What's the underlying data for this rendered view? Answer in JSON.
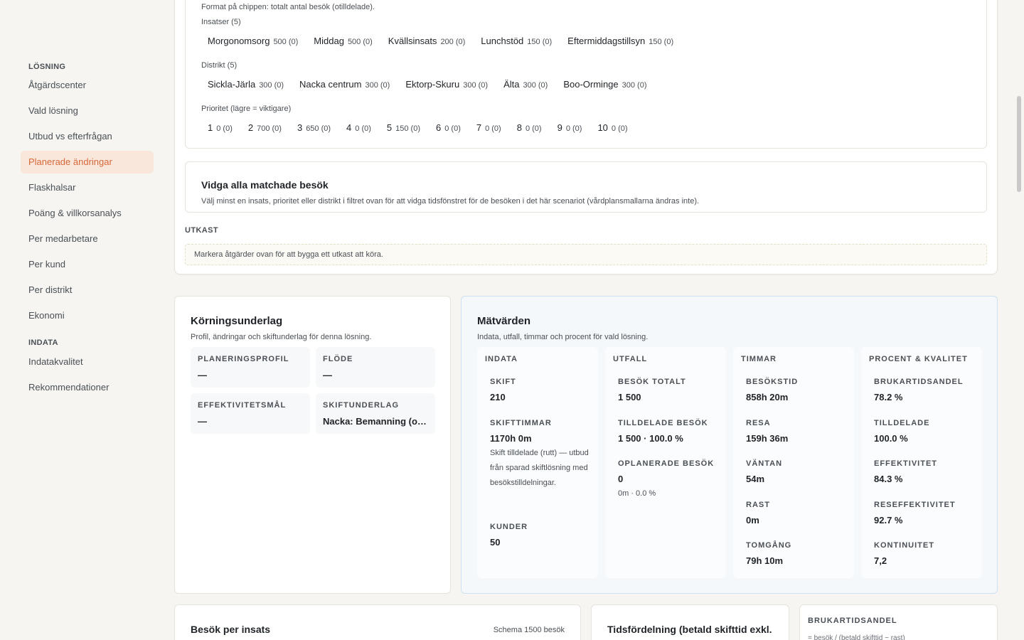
{
  "sidebar": {
    "sections": [
      {
        "label": "LÖSNING",
        "items": [
          "Åtgärdscenter",
          "Vald lösning",
          "Utbud vs efterfrågan",
          "Planerade ändringar",
          "Flaskhalsar",
          "Poäng & villkorsanalys",
          "Per medarbetare",
          "Per kund",
          "Per distrikt",
          "Ekonomi"
        ]
      },
      {
        "label": "INDATA",
        "items": [
          "Indatakvalitet",
          "Rekommendationer"
        ]
      }
    ],
    "active": "Planerade ändringar"
  },
  "filters": {
    "format_note": "Format på chippen: totalt antal besök (otilldelade).",
    "groups": [
      {
        "label": "Insatser (5)",
        "chips": [
          {
            "name": "Morgonomsorg",
            "count": "500 (0)"
          },
          {
            "name": "Middag",
            "count": "500 (0)"
          },
          {
            "name": "Kvällsinsats",
            "count": "200 (0)"
          },
          {
            "name": "Lunchstöd",
            "count": "150 (0)"
          },
          {
            "name": "Eftermiddagstillsyn",
            "count": "150 (0)"
          }
        ]
      },
      {
        "label": "Distrikt (5)",
        "chips": [
          {
            "name": "Sickla-Järla",
            "count": "300 (0)"
          },
          {
            "name": "Nacka centrum",
            "count": "300 (0)"
          },
          {
            "name": "Ektorp-Skuru",
            "count": "300 (0)"
          },
          {
            "name": "Älta",
            "count": "300 (0)"
          },
          {
            "name": "Boo-Orminge",
            "count": "300 (0)"
          }
        ]
      },
      {
        "label": "Prioritet (lägre = viktigare)",
        "chips": [
          {
            "name": "1",
            "count": "0 (0)"
          },
          {
            "name": "2",
            "count": "700 (0)"
          },
          {
            "name": "3",
            "count": "650 (0)"
          },
          {
            "name": "4",
            "count": "0 (0)"
          },
          {
            "name": "5",
            "count": "150 (0)"
          },
          {
            "name": "6",
            "count": "0 (0)"
          },
          {
            "name": "7",
            "count": "0 (0)"
          },
          {
            "name": "8",
            "count": "0 (0)"
          },
          {
            "name": "9",
            "count": "0 (0)"
          },
          {
            "name": "10",
            "count": "0 (0)"
          }
        ]
      }
    ]
  },
  "vidga": {
    "title": "Vidga alla matchade besök",
    "text": "Välj minst en insats, prioritet eller distrikt i filtret ovan för att vidga tidsfönstret för de besöken i det här scenariot (vårdplansmallarna ändras inte)."
  },
  "utkast": {
    "label": "UTKAST",
    "text": "Markera åtgärder ovan för att bygga ett utkast att köra."
  },
  "korning": {
    "title": "Körningsunderlag",
    "subtitle": "Profil, ändringar och skiftunderlag för denna lösning.",
    "fields": [
      {
        "key": "PLANERINGSPROFIL",
        "value": "—"
      },
      {
        "key": "FLÖDE",
        "value": "—"
      },
      {
        "key": "EFFEKTIVITETSMÅL",
        "value": "—"
      },
      {
        "key": "SKIFTUNDERLAG",
        "value": "Nacka: Bemanning (o…"
      }
    ]
  },
  "matvarden": {
    "title": "Mätvärden",
    "subtitle": "Indata, utfall, timmar och procent för vald lösning.",
    "columns": [
      {
        "header": "INDATA",
        "metrics": [
          {
            "key": "SKIFT",
            "value": "210",
            "note": ""
          },
          {
            "key": "SKIFTTIMMAR",
            "value": "1170h 0m",
            "note": "Skift tilldelade (rutt) — utbud från sparad skiftlösning med besökstilldelningar."
          },
          {
            "key": "KUNDER",
            "value": "50",
            "note": ""
          }
        ]
      },
      {
        "header": "UTFALL",
        "metrics": [
          {
            "key": "BESÖK TOTALT",
            "value": "1 500",
            "note": ""
          },
          {
            "key": "TILLDELADE BESÖK",
            "value": "1 500 · 100.0 %",
            "note": ""
          },
          {
            "key": "OPLANERADE BESÖK",
            "value": "0",
            "note": "0m · 0.0 %"
          }
        ]
      },
      {
        "header": "TIMMAR",
        "metrics": [
          {
            "key": "BESÖKSTID",
            "value": "858h 20m",
            "note": ""
          },
          {
            "key": "RESA",
            "value": "159h 36m",
            "note": ""
          },
          {
            "key": "VÄNTAN",
            "value": "54m",
            "note": ""
          },
          {
            "key": "RAST",
            "value": "0m",
            "note": ""
          },
          {
            "key": "TOMGÅNG",
            "value": "79h 10m",
            "note": ""
          }
        ]
      },
      {
        "header": "PROCENT & KVALITET",
        "metrics": [
          {
            "key": "BRUKARTIDSANDEL",
            "value": "78.2 %",
            "note": ""
          },
          {
            "key": "TILLDELADE",
            "value": "100.0 %",
            "note": ""
          },
          {
            "key": "EFFEKTIVITET",
            "value": "84.3 %",
            "note": ""
          },
          {
            "key": "RESEFFEKTIVITET",
            "value": "92.7 %",
            "note": ""
          },
          {
            "key": "KONTINUITET",
            "value": "7,2",
            "note": ""
          }
        ]
      }
    ]
  },
  "bottom": {
    "besok_title": "Besök per insats",
    "besok_right": "Schema 1500 besök",
    "tid_title": "Tidsfördelning (betald skifttid exkl.",
    "bruk_label": "BRUKARTIDSANDEL",
    "bruk_sub": "= besök / (betald skifttid − rast)"
  },
  "colors": {
    "accent": "#d9683a",
    "accent_bg": "#f9e7dc",
    "metrics_border": "#cfe0f1"
  }
}
